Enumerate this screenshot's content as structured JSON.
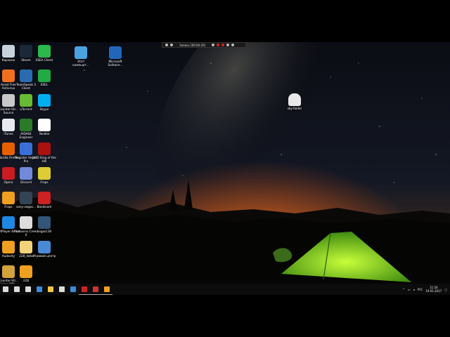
{
  "recorder": {
    "title": "Запись [00:00:20]"
  },
  "desktop": {
    "icons": [
      {
        "label": "Корзина",
        "icon": "recycle-bin-icon",
        "color": "#c7d2dc"
      },
      {
        "label": "Steam",
        "icon": "steam-icon",
        "color": "#1b2838"
      },
      {
        "label": "ESEA Client",
        "icon": "esea-icon",
        "color": "#2db84d"
      },
      {
        "label": "Avast Free Antivirus",
        "icon": "avast-icon",
        "color": "#f07020"
      },
      {
        "label": "TeamSpeak 3 Client",
        "icon": "teamspeak-icon",
        "color": "#2b6cb0"
      },
      {
        "label": "ESEL",
        "icon": "esel-icon",
        "color": "#22aa44"
      },
      {
        "label": "Counter-Str... Source",
        "icon": "css-icon",
        "color": "#c8c8c8"
      },
      {
        "label": "uTorrent",
        "icon": "utorrent-icon",
        "color": "#66bb33"
      },
      {
        "label": "Skype",
        "icon": "skype-icon",
        "color": "#00aff0"
      },
      {
        "label": "iTunes",
        "icon": "itunes-icon",
        "color": "#e8e8f0"
      },
      {
        "label": "AIDA64 Engineer",
        "icon": "aida64-icon",
        "color": "#2a7a2a"
      },
      {
        "label": "Yandex",
        "icon": "yandex-icon",
        "color": "#ffffff"
      },
      {
        "label": "Mozilla Firefox",
        "icon": "firefox-icon",
        "color": "#e66000"
      },
      {
        "label": "Register Vegas Pro",
        "icon": "vegas-register-icon",
        "color": "#3a6fd8"
      },
      {
        "label": "HUD King of the Hill",
        "icon": "hud-icon",
        "color": "#aa1111"
      },
      {
        "label": "Opera",
        "icon": "opera-icon",
        "color": "#cc1b22"
      },
      {
        "label": "Discord",
        "icon": "discord-icon",
        "color": "#7289da"
      },
      {
        "label": "Fraps",
        "icon": "fraps-icon",
        "color": "#ddcc33"
      },
      {
        "label": "Fraps",
        "icon": "fraps-mascot-icon",
        "color": "#f0a020"
      },
      {
        "label": "sony-vegas...",
        "icon": "vegas-icon",
        "color": "#334455"
      },
      {
        "label": "Bandicam",
        "icon": "bandicam-icon",
        "color": "#cc2222"
      },
      {
        "label": "PotPlayer 64 bit",
        "icon": "potplayer-icon",
        "color": "#1e88e5"
      },
      {
        "label": "Assassins Creed II",
        "icon": "assassins-creed-icon",
        "color": "#dddddd"
      },
      {
        "label": "vegas130",
        "icon": "vegas130-icon",
        "color": "#335577"
      },
      {
        "label": "Audacity",
        "icon": "audacity-icon",
        "color": "#f0a020"
      },
      {
        "label": "228_data",
        "icon": "folder-icon",
        "color": "#f4d27a"
      },
      {
        "label": "Игровой центр",
        "icon": "game-center-icon",
        "color": "#4a8ad4"
      },
      {
        "label": "Counter-Str... Global Offe...",
        "icon": "csgo-icon",
        "color": "#d4a23a"
      },
      {
        "label": "228",
        "icon": "mascot-icon",
        "color": "#f0a020"
      },
      {
        "label": "Этот компьют...",
        "icon": "this-pc-icon",
        "color": "#4aa3df"
      },
      {
        "label": "Microsoft Solitaire...",
        "icon": "solitaire-icon",
        "color": "#2266bb"
      }
    ],
    "floating_icon": {
      "label": "sky-folder",
      "icon": "cloud-folder-icon",
      "color": "#e8e8e8"
    }
  },
  "taskbar": {
    "items": [
      {
        "icon": "windows-start-icon",
        "color": "#dddddd"
      },
      {
        "icon": "search-icon",
        "color": "#dddddd"
      },
      {
        "icon": "task-view-icon",
        "color": "#dddddd"
      },
      {
        "icon": "edge-icon",
        "color": "#3b8cd9"
      },
      {
        "icon": "file-explorer-icon",
        "color": "#f4c542"
      },
      {
        "icon": "store-icon",
        "color": "#dddddd"
      },
      {
        "icon": "mail-icon",
        "color": "#3b8cd9"
      },
      {
        "icon": "bandicam-taskbar-icon",
        "color": "#cc2222"
      },
      {
        "icon": "obs-icon",
        "color": "#cc3333"
      },
      {
        "icon": "fraps-taskbar-icon",
        "color": "#f0a020"
      }
    ],
    "tray_lang": "РУС",
    "time": "11:50",
    "date": "19.01.2017"
  }
}
